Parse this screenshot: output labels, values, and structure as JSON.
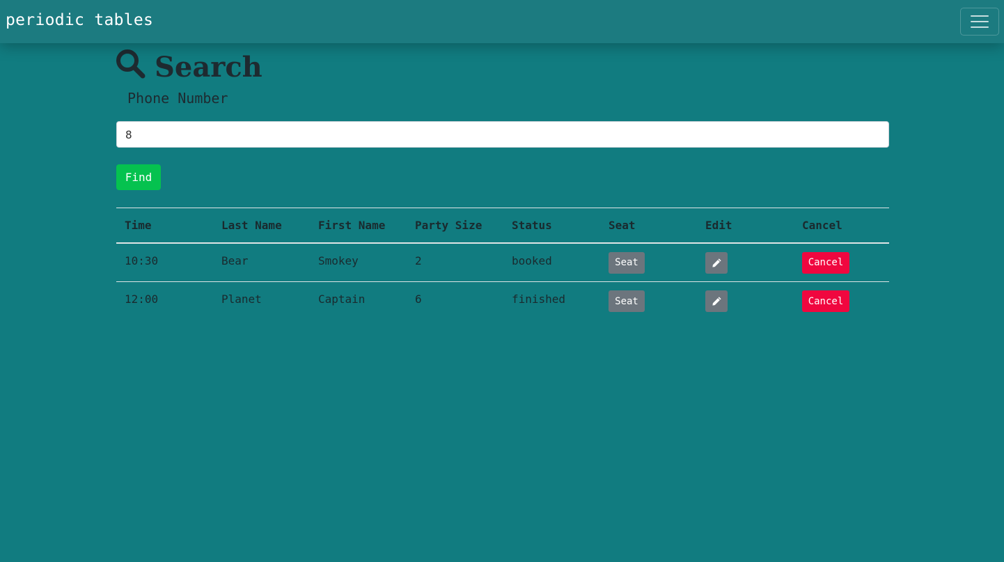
{
  "navbar": {
    "brand": "periodic tables",
    "toggle_icon": "hamburger-menu-icon"
  },
  "search": {
    "icon": "search-icon",
    "title": "Search",
    "label": "Phone Number",
    "value": "8",
    "find_label": "Find"
  },
  "colors": {
    "background": "#117c80",
    "navbar": "#1c7b80",
    "find": "#05c24f",
    "seat": "#6c757d",
    "edit": "#6c757d",
    "cancel": "#f0073f"
  },
  "table": {
    "headers": [
      "Time",
      "Last Name",
      "First Name",
      "Party Size",
      "Status",
      "Seat",
      "Edit",
      "Cancel"
    ],
    "rows": [
      {
        "time": "10:30",
        "last_name": "Bear",
        "first_name": "Smokey",
        "party_size": "2",
        "status": "booked",
        "seat_label": "Seat",
        "edit_icon": "pencil-icon",
        "cancel_label": "Cancel"
      },
      {
        "time": "12:00",
        "last_name": "Planet",
        "first_name": "Captain",
        "party_size": "6",
        "status": "finished",
        "seat_label": "Seat",
        "edit_icon": "pencil-icon",
        "cancel_label": "Cancel"
      }
    ]
  }
}
